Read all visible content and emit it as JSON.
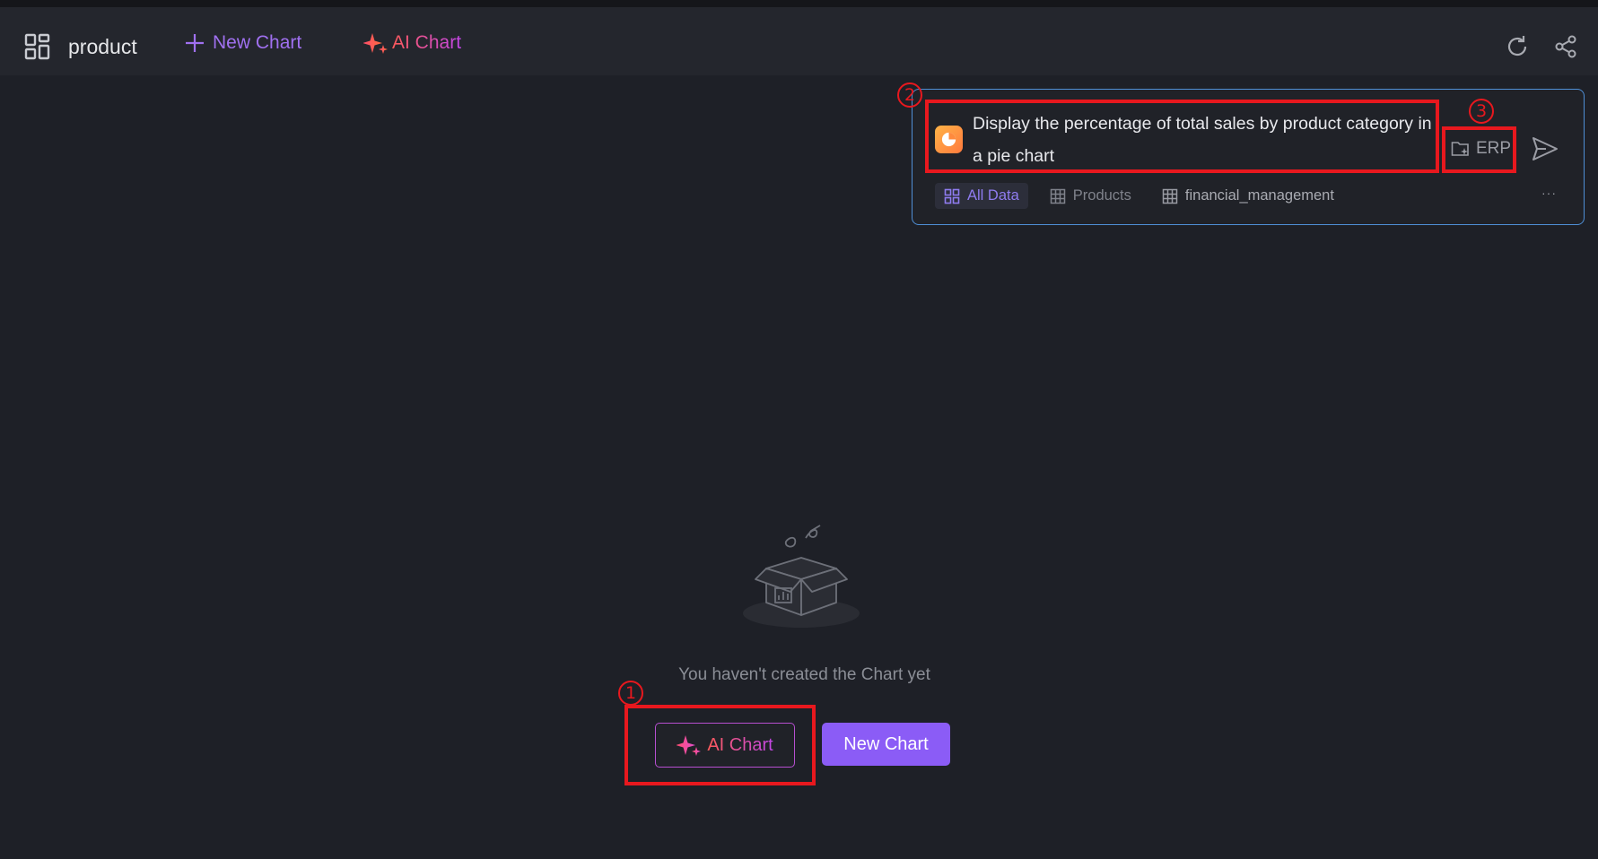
{
  "header": {
    "page_name": "product",
    "new_chart_label": "New Chart",
    "ai_chart_label": "AI Chart",
    "icons": [
      "dashboard-icon",
      "plus-icon",
      "sparkle-icon",
      "refresh-icon",
      "share-icon"
    ]
  },
  "ai_panel": {
    "prompt": "Display the percentage of total sales by product category in a pie chart",
    "datasource_label": "ERP",
    "tabs": [
      {
        "label": "All Data",
        "active": true
      },
      {
        "label": "Products",
        "active": false
      },
      {
        "label": "financial_management",
        "active": false
      }
    ],
    "more_label": "···"
  },
  "empty_state": {
    "message": "You haven't created the Chart yet",
    "ai_chart_label": "AI Chart",
    "new_chart_label": "New Chart"
  },
  "annotations": {
    "marker_1": "1",
    "marker_2": "2",
    "marker_3": "3"
  },
  "colors": {
    "accent_purple": "#8b5cf6",
    "annotation_red": "#e8181e",
    "panel_border": "#4f8fd6"
  }
}
